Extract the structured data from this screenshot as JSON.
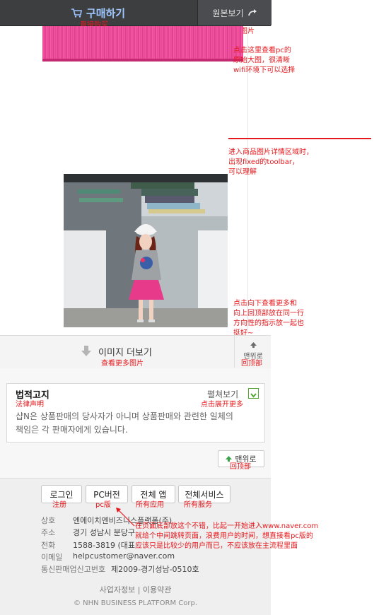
{
  "topbar": {
    "buy_label": "구매하기",
    "original_label": "원본보기"
  },
  "main": {
    "more_images_label": "이미지 더보기",
    "to_top_small_label": "맨위로"
  },
  "legal": {
    "title": "법적고지",
    "expand_label": "펼쳐보기",
    "text_line1": "샵N은 상품판매의 당사자가 아니며 상품판매와 관련한 일체의",
    "text_line2": "책임은 각 판매자에게 있습니다.",
    "to_top_label": "맨위로"
  },
  "footer": {
    "buttons": [
      "로그인",
      "PC버전",
      "전체 앱",
      "전체서비스"
    ],
    "info": [
      {
        "key": "상호",
        "value": "엔에이치엔비즈니스플랫폼(주)"
      },
      {
        "key": "주소",
        "value": "경기 성남시 분당구"
      },
      {
        "key": "전화",
        "value": "1588-3819 (대표"
      },
      {
        "key": "이메일",
        "value": "helpcustomer@naver.com"
      },
      {
        "key": "통신판매업신고번호",
        "value": "제2009-경기성남-0510호"
      }
    ],
    "links": "사업자정보 | 이용약관",
    "copyright": "© NHN BUSINESS PLATFORM Corp."
  },
  "annotations": {
    "buy_direct": "直接购买",
    "view_original": "查看原始图片",
    "pc_original": [
      "点击这里查看pc的",
      "原始大图，很清晰",
      "wifi环境下可以选择"
    ],
    "fixed_toolbar": [
      "进入商品图片详情区域时，",
      "出现fixed的toolbar，",
      "可以理解"
    ],
    "more_and_top": [
      "点击向下查看更多和",
      "向上回顶部放在同一行",
      "方向性的指示放一起也",
      "挺好~"
    ],
    "view_more_images": "查看更多图片",
    "back_to_top_1": [
      "回顶部"
    ],
    "legal_notice": "法律声明",
    "expand_more": "点击展开更多",
    "back_to_top_2": "回顶部",
    "login": "注册",
    "pc_version": "pc版",
    "all_apps": "所有应用",
    "all_services": "所有服务",
    "bottom_comment": [
      "在页面底部放这个不错，比起一开始进入www.naver.com",
      "就给个中间跳转页面，浪费用户的时间，想直接看pc版的",
      "应该只是比较少的用户而已，不应该放在主流程里面"
    ]
  },
  "colors": {
    "accent_red": "#e5191d",
    "topbar": "#3d3e40",
    "buy_blue": "#9ec6ff",
    "legal_green": "#53a532"
  },
  "icons": [
    "cart-icon",
    "share-arrow-icon",
    "down-arrow-icon",
    "up-arrow-icon",
    "check-icon"
  ]
}
